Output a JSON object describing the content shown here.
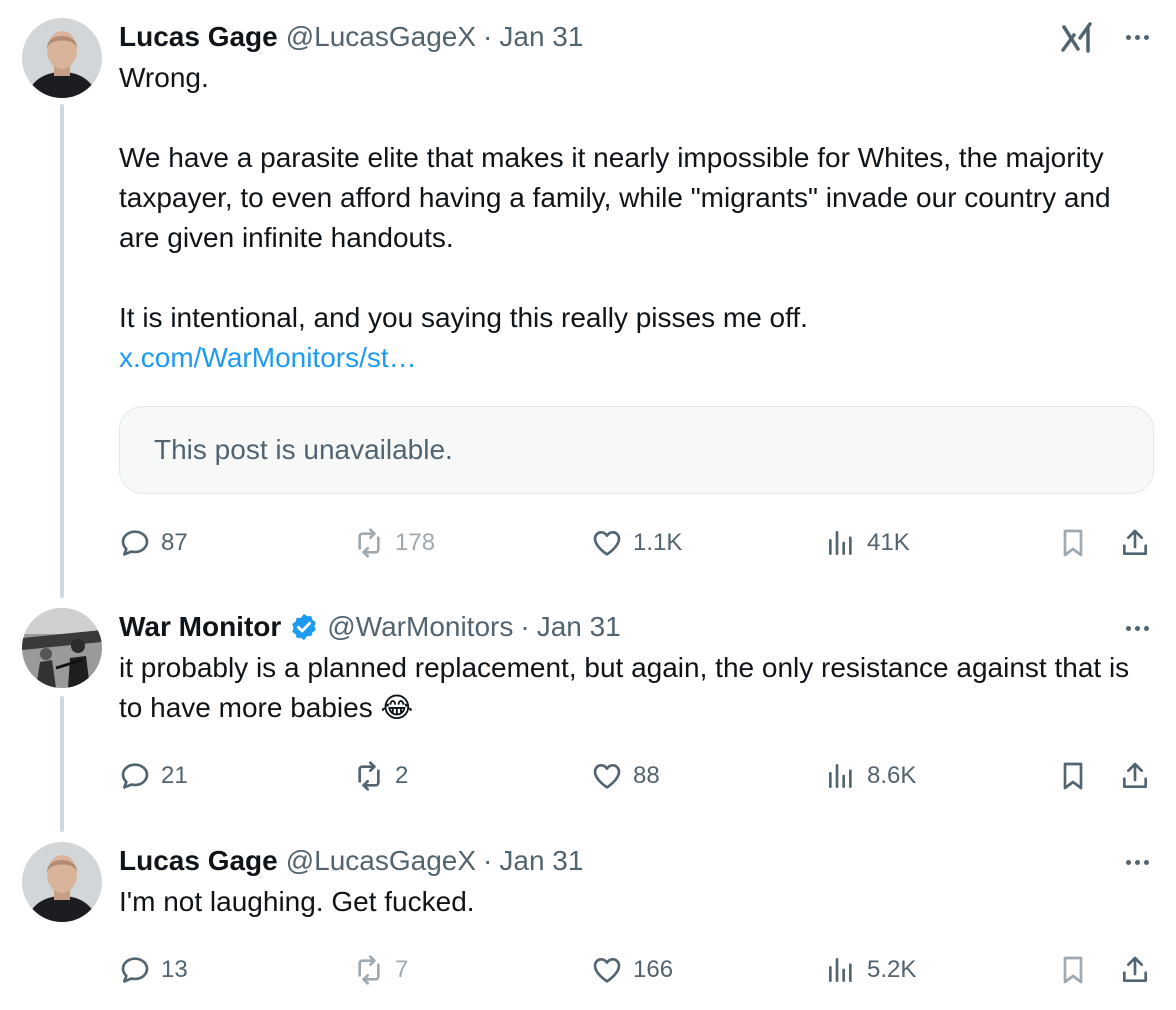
{
  "tweets": [
    {
      "name": "Lucas Gage",
      "handle": "@LucasGageX",
      "dot": "·",
      "date": "Jan 31",
      "paragraphs": [
        "Wrong.",
        "We have a parasite elite that makes it nearly impossible for Whites, the majority taxpayer, to even afford having a family, while \"migrants\" invade our country and are given infinite handouts.",
        "It is intentional, and you saying this really pisses me off."
      ],
      "link": "x.com/WarMonitors/st…",
      "quote": "This post is unavailable.",
      "replies": "87",
      "reposts": "178",
      "likes": "1.1K",
      "views": "41K"
    },
    {
      "name": "War Monitor",
      "handle": "@WarMonitors",
      "dot": "·",
      "date": "Jan 31",
      "text": "it probably is a planned replacement, but again, the only resistance against that is to have more babies 😂",
      "replies": "21",
      "reposts": "2",
      "likes": "88",
      "views": "8.6K"
    },
    {
      "name": "Lucas Gage",
      "handle": "@LucasGageX",
      "dot": "·",
      "date": "Jan 31",
      "text": "I'm not laughing. Get fucked.",
      "replies": "13",
      "reposts": "7",
      "likes": "166",
      "views": "5.2K"
    }
  ],
  "icons": {
    "brand": "grok-icon",
    "more": "more-icon",
    "reply": "reply-icon",
    "repost": "repost-icon",
    "like": "like-icon",
    "views": "views-icon",
    "bookmark": "bookmark-icon",
    "share": "share-icon",
    "verified": "verified-badge-icon"
  },
  "colors": {
    "link": "#1d9bf0",
    "muted": "#536471",
    "verified": "#1d9bf0",
    "text": "#0f1419"
  }
}
